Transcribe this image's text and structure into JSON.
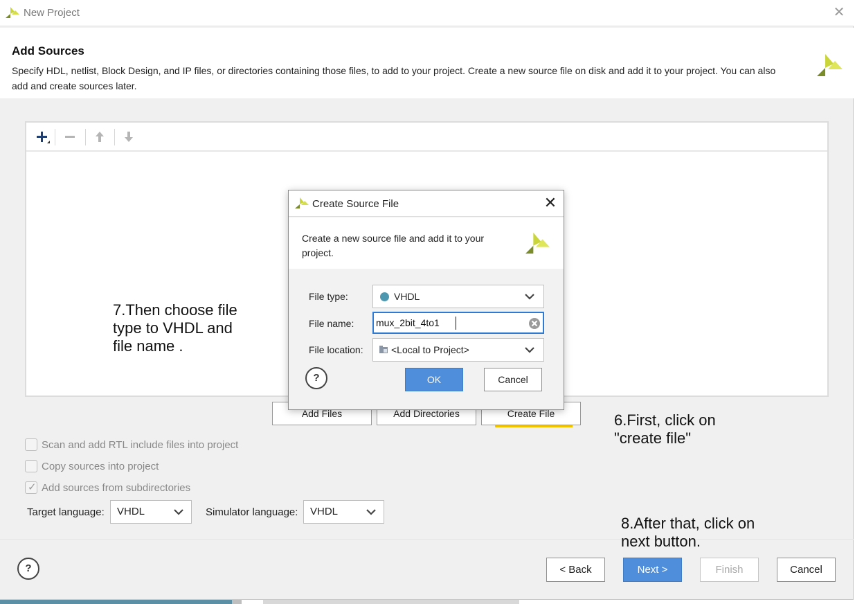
{
  "window": {
    "title": "New Project"
  },
  "page": {
    "heading": "Add Sources",
    "description": "Specify HDL, netlist, Block Design, and IP files, or directories containing those files, to add to your project. Create a new source file on disk and add it to your project. You can also add and create sources later."
  },
  "toolbar": {
    "add_icon": "plus-icon",
    "remove_icon": "minus-icon",
    "up_icon": "arrow-up-icon",
    "down_icon": "arrow-down-icon"
  },
  "add_buttons": {
    "add_files": "Add Files",
    "add_directories": "Add Directories",
    "create_file": "Create File"
  },
  "options": {
    "scan_rtl": "Scan and add RTL include files into project",
    "copy_sources": "Copy sources into project",
    "add_subdirs": "Add sources from subdirectories",
    "scan_rtl_checked": false,
    "copy_sources_checked": false,
    "add_subdirs_checked": true
  },
  "languages": {
    "target_label": "Target language:",
    "target_value": "VHDL",
    "simulator_label": "Simulator language:",
    "simulator_value": "VHDL"
  },
  "footer": {
    "help": "?",
    "back": "< Back",
    "next": "Next >",
    "finish": "Finish",
    "cancel": "Cancel"
  },
  "annotations": {
    "step7": "7.Then choose file\ntype to VHDL and\nfile name .",
    "step6": "6.First, click on\n\"create file\"",
    "step8": "8.After that, click on\nnext button."
  },
  "dialog": {
    "title": "Create Source File",
    "description": "Create a new source file and add it to your project.",
    "file_type_label": "File type:",
    "file_type_value": "VHDL",
    "file_name_label": "File name:",
    "file_name_value": "mux_2bit_4to1",
    "file_location_label": "File location:",
    "file_location_value": "<Local to Project>",
    "help": "?",
    "ok": "OK",
    "cancel": "Cancel"
  },
  "colors": {
    "accent": "#4f8edb",
    "vhdl_dot": "#4d98b0",
    "highlight_mark": "#f3c200"
  }
}
